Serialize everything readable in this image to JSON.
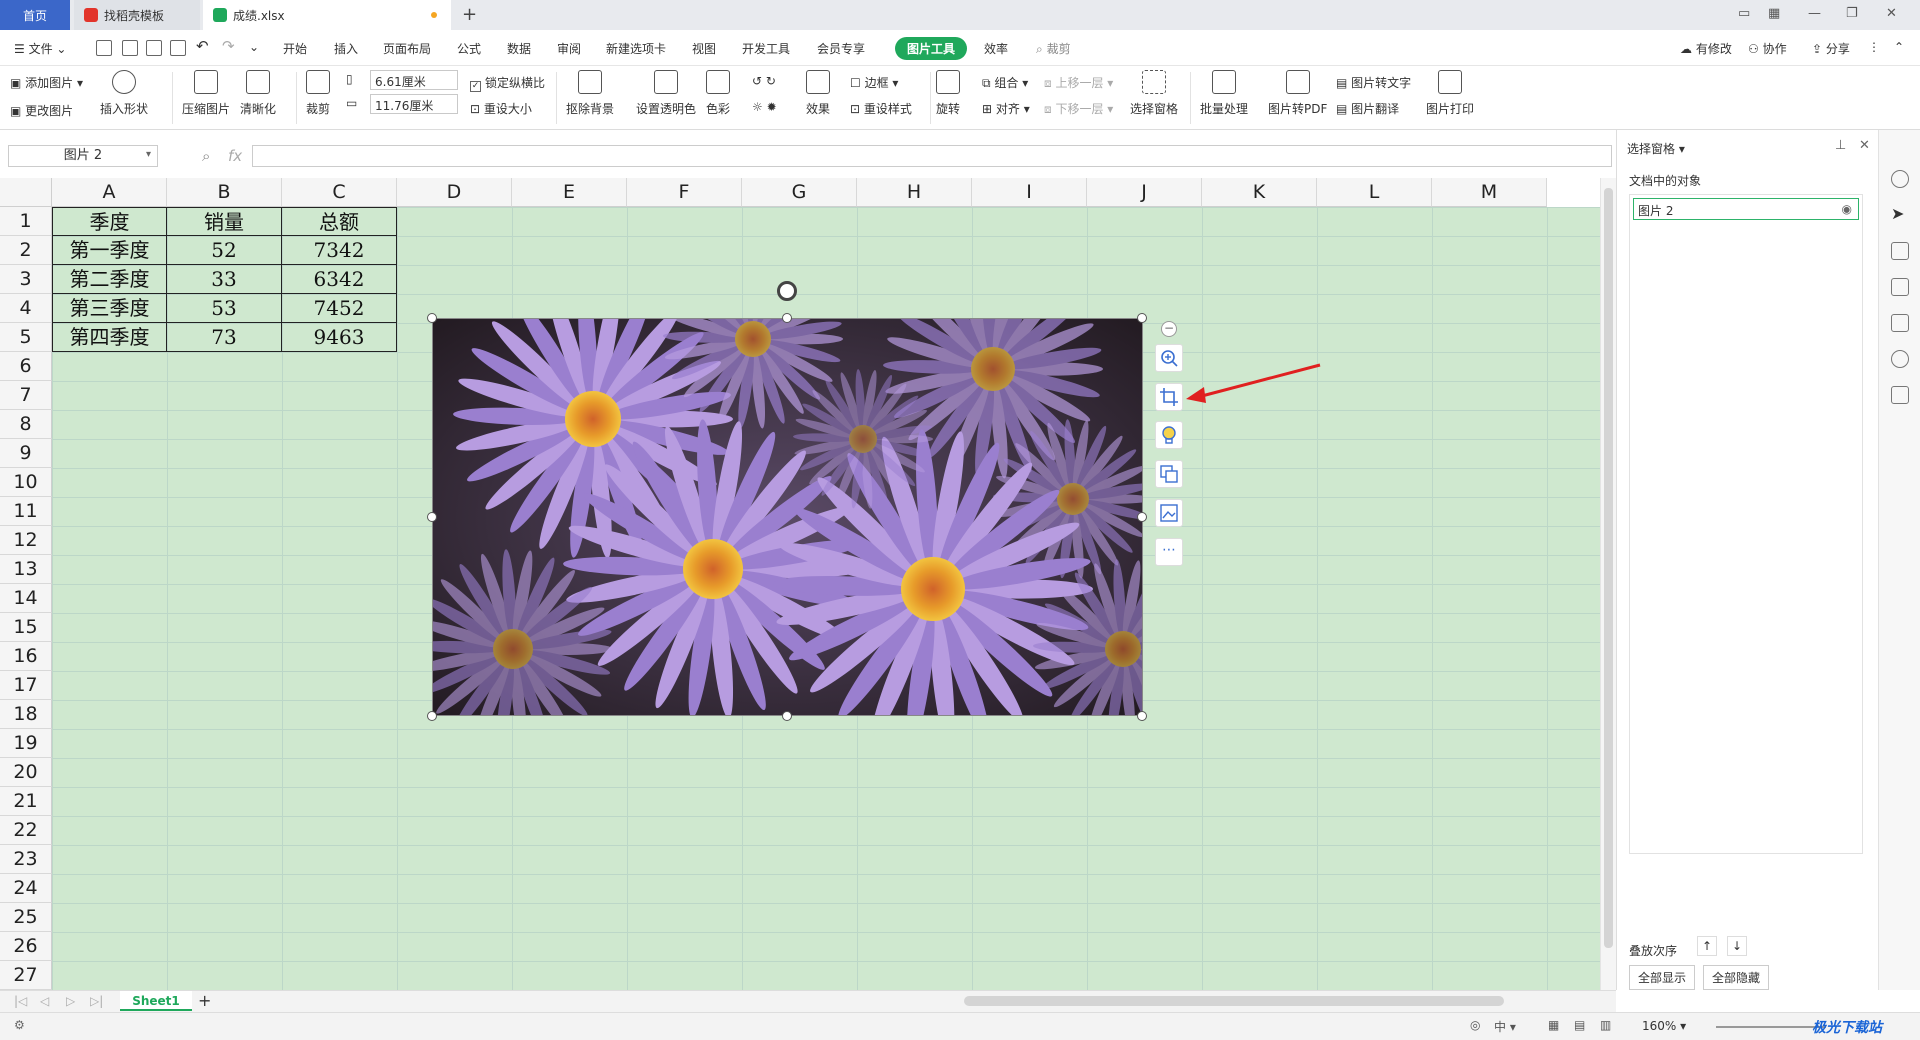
{
  "tabs": {
    "home": "首页",
    "template": "找稻壳模板",
    "file": "成绩.xlsx"
  },
  "menu": {
    "file": "文件",
    "items": [
      "开始",
      "插入",
      "页面布局",
      "公式",
      "数据",
      "审阅",
      "新建选项卡",
      "视图",
      "开发工具",
      "会员专享",
      "图片工具",
      "效率"
    ],
    "search": "裁剪",
    "modified": "有修改",
    "collab": "协作",
    "share": "分享"
  },
  "ribbon": {
    "add_image": "添加图片",
    "change_image": "更改图片",
    "insert_shape": "插入形状",
    "compress": "压缩图片",
    "sharpen": "清晰化",
    "crop": "裁剪",
    "width": "6.61厘米",
    "height": "11.76厘米",
    "lock_ratio": "锁定纵横比",
    "reset_size": "重设大小",
    "remove_bg": "抠除背景",
    "transparent": "设置透明色",
    "color": "色彩",
    "effect": "效果",
    "border": "边框",
    "reset_style": "重设样式",
    "rotate": "旋转",
    "group": "组合",
    "align": "对齐",
    "bring_forward": "上移一层",
    "send_backward": "下移一层",
    "selection_pane": "选择窗格",
    "batch": "批量处理",
    "to_pdf": "图片转PDF",
    "to_text": "图片转文字",
    "translate": "图片翻译",
    "print": "图片打印"
  },
  "formula": {
    "namebox": "图片 2",
    "fx": "fx"
  },
  "columns": [
    "A",
    "B",
    "C",
    "D",
    "E",
    "F",
    "G",
    "H",
    "I",
    "J",
    "K",
    "L",
    "M"
  ],
  "rows": [
    "1",
    "2",
    "3",
    "4",
    "5",
    "6",
    "7",
    "8",
    "9",
    "10",
    "11",
    "12",
    "13",
    "14",
    "15",
    "16",
    "17",
    "18",
    "19",
    "20",
    "21",
    "22",
    "23",
    "24",
    "25",
    "26",
    "27"
  ],
  "table": [
    [
      "季度",
      "销量",
      "总额"
    ],
    [
      "第一季度",
      "52",
      "7342"
    ],
    [
      "第二季度",
      "33",
      "6342"
    ],
    [
      "第三季度",
      "53",
      "7452"
    ],
    [
      "第四季度",
      "73",
      "9463"
    ]
  ],
  "pane": {
    "title": "选择窗格",
    "section": "文档中的对象",
    "object": "图片 2",
    "order": "叠放次序",
    "show_all": "全部显示",
    "hide_all": "全部隐藏"
  },
  "sheet": {
    "name": "Sheet1"
  },
  "status": {
    "zoom": "160%"
  },
  "watermark": "极光下载站"
}
